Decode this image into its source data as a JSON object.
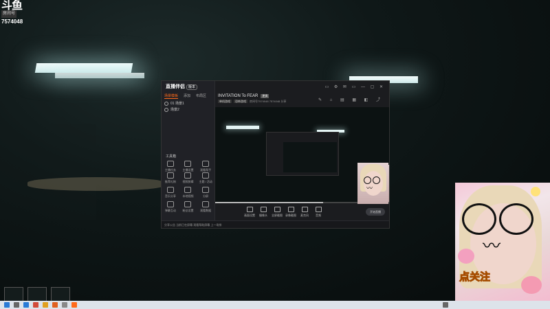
{
  "overlay": {
    "logo_mark": "斗鱼",
    "logo_tag": "房间号",
    "room_id": "7574048"
  },
  "app": {
    "title": "直播伴侣",
    "version": "版本",
    "left_tabs": [
      {
        "label": "场景模板",
        "active": true
      },
      {
        "label": "添加",
        "active": false
      },
      {
        "label": "布局区",
        "active": false
      }
    ],
    "scenes": [
      "01 场景1",
      "场景2"
    ],
    "tools_title": "工具箱",
    "tool_rows": [
      [
        "主播任务",
        "主播设置",
        "观看帮手"
      ],
      [
        "推荐礼物",
        "视频剪辑",
        "主题 / 活动"
      ],
      [
        "音乐分享",
        "本地视频",
        "分屏"
      ],
      [
        "弹幕互动",
        "粉丝设置",
        "观看数据"
      ]
    ],
    "stream_title": "INVITATION To FEAR",
    "stream_badge": "更换",
    "stream_meta": [
      "单机游戏",
      "恐怖游戏",
      "房间号7574048",
      "7574048",
      "分享"
    ],
    "window_controls": "▭ ⚙ ✉ ▭ — ▢ ✕",
    "top_icons": "✎ ⌂ ▤ ▦ ◧ ⤴",
    "control_buttons": [
      "画面设置",
      "摄像头",
      "全屏截图",
      "录像截图",
      "麦克风",
      "音频"
    ],
    "go_live": "开始直播",
    "status_bar": "分享公告  当前已在屏幕  观看帮助屏幕  上一场排"
  },
  "webcam": {
    "sticker_text": "点关注"
  }
}
